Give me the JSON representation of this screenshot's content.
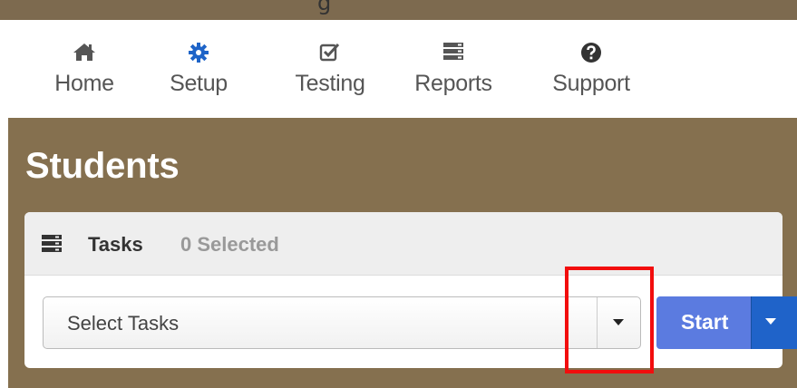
{
  "header": {
    "cut_title": "g"
  },
  "nav": {
    "items": [
      {
        "label": "Home",
        "icon": "home-icon"
      },
      {
        "label": "Setup",
        "icon": "gear-icon"
      },
      {
        "label": "Testing",
        "icon": "checkbox-icon"
      },
      {
        "label": "Reports",
        "icon": "server-icon"
      },
      {
        "label": "Support",
        "icon": "question-circle-icon"
      }
    ]
  },
  "main": {
    "title": "Students",
    "panel": {
      "title": "Tasks",
      "selected_count": "0 Selected",
      "select": {
        "value": "Select Tasks"
      },
      "start_label": "Start"
    }
  },
  "colors": {
    "brand_brown": "#85704f",
    "start_blue": "#5b7be0",
    "caret_blue": "#1f63c9",
    "nav_blue": "#1e64c8",
    "highlight_red": "#f20d0d"
  }
}
